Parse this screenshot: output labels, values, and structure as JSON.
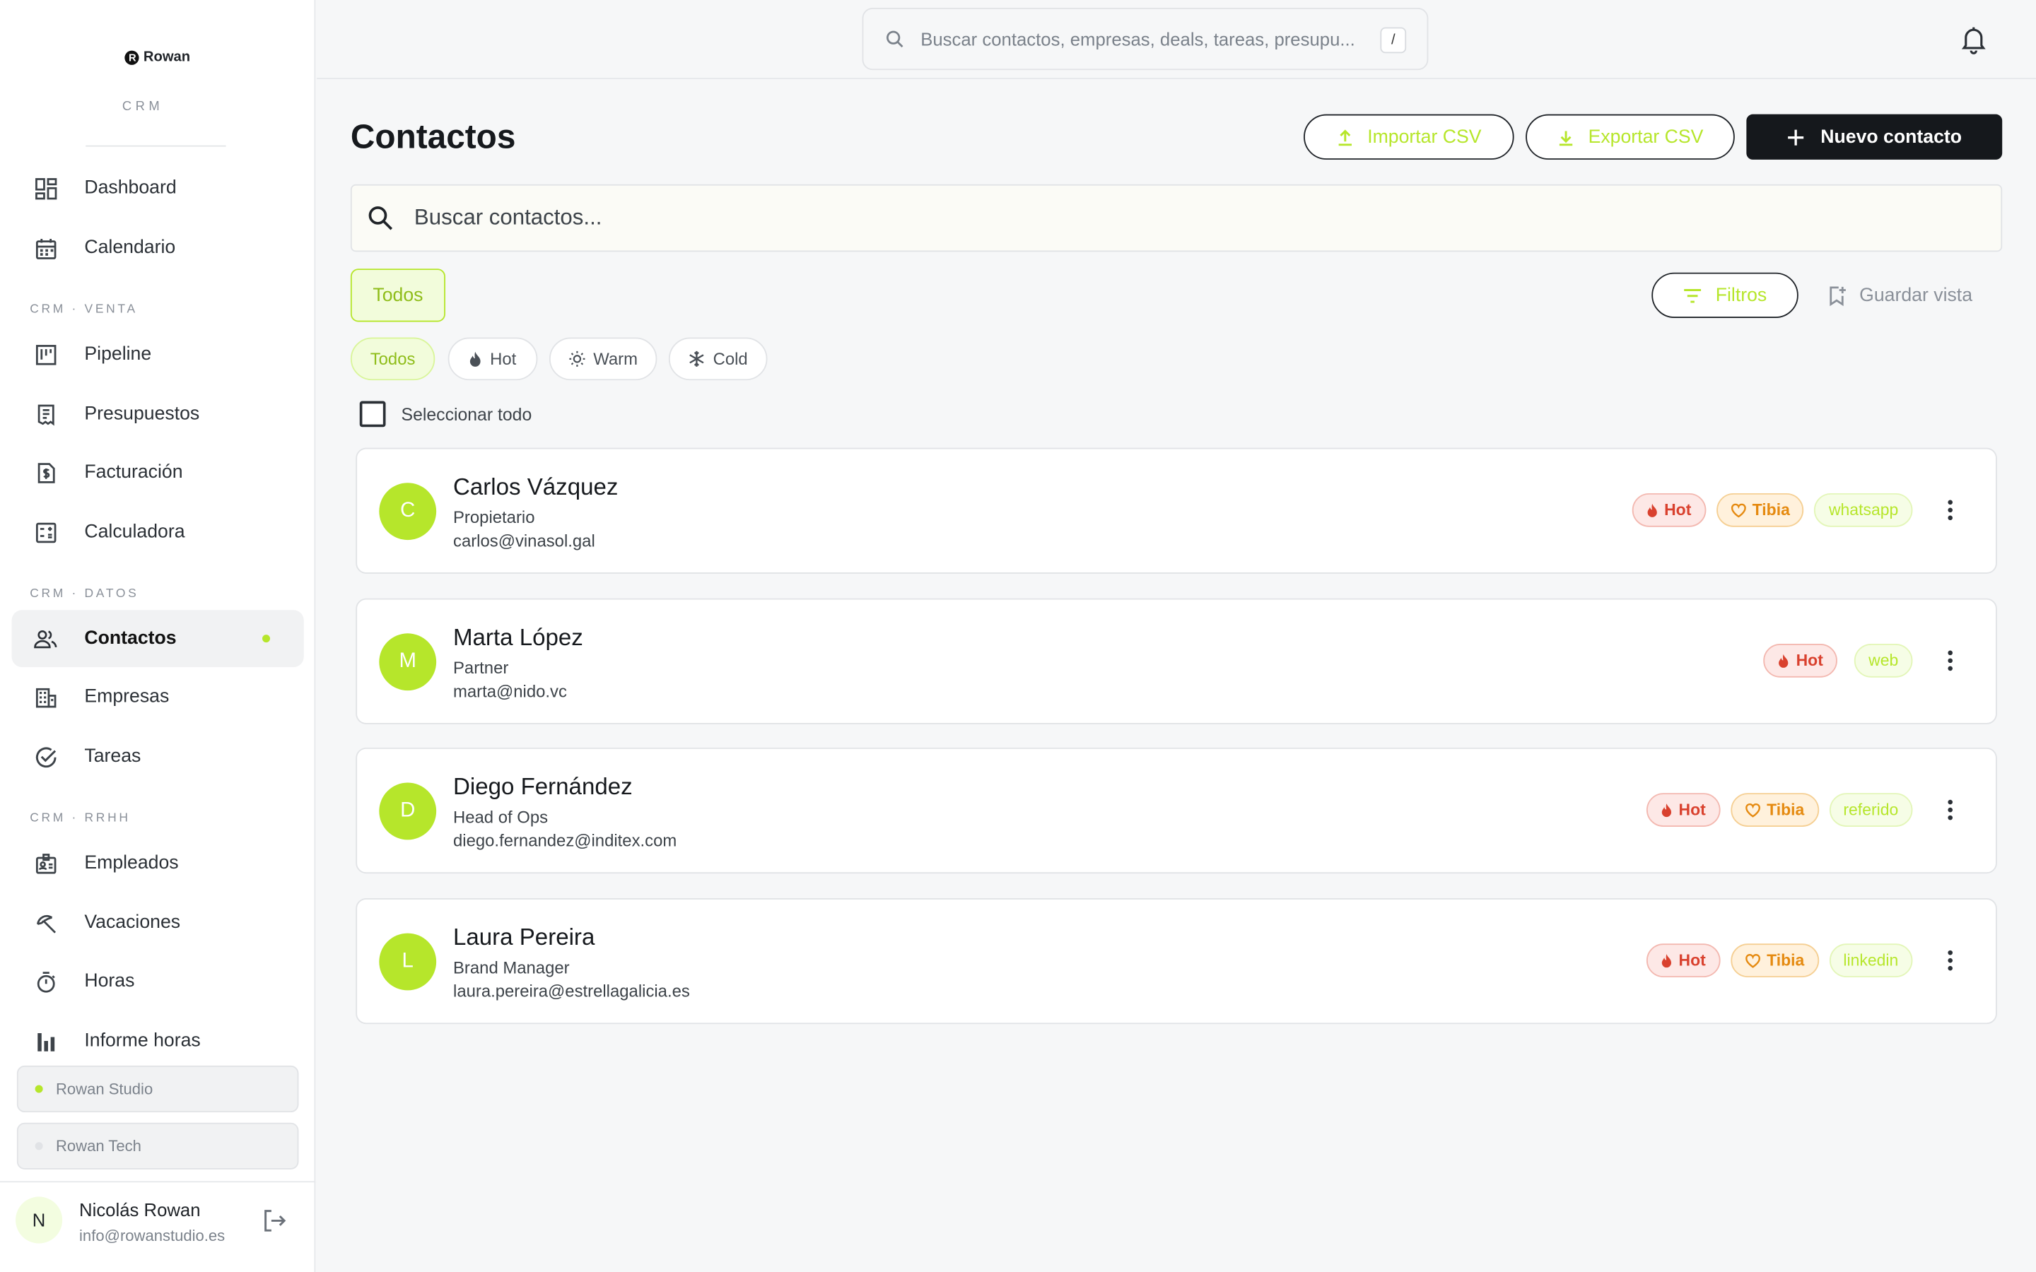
{
  "brand": {
    "logo_text": "Rowan",
    "logo_mark": "R",
    "sub": "CRM"
  },
  "sidebar": {
    "items_top": [
      {
        "label": "Dashboard",
        "icon": "dashboard-icon"
      },
      {
        "label": "Calendario",
        "icon": "calendar-icon"
      }
    ],
    "section_venta": "CRM · VENTA",
    "items_venta": [
      {
        "label": "Pipeline",
        "icon": "pipeline-icon"
      },
      {
        "label": "Presupuestos",
        "icon": "receipt-icon"
      },
      {
        "label": "Facturación",
        "icon": "invoice-icon"
      },
      {
        "label": "Calculadora",
        "icon": "calculator-icon"
      }
    ],
    "section_datos": "CRM · DATOS",
    "items_datos": [
      {
        "label": "Contactos",
        "icon": "people-icon",
        "active": true
      },
      {
        "label": "Empresas",
        "icon": "building-icon"
      },
      {
        "label": "Tareas",
        "icon": "check-circle-icon"
      }
    ],
    "section_rrhh": "CRM · RRHH",
    "items_rrhh": [
      {
        "label": "Empleados",
        "icon": "badge-icon"
      },
      {
        "label": "Vacaciones",
        "icon": "beach-icon"
      },
      {
        "label": "Horas",
        "icon": "timer-icon"
      },
      {
        "label": "Informe horas",
        "icon": "bar-chart-icon"
      }
    ],
    "workspaces": [
      {
        "label": "Rowan Studio",
        "dot_color": "#b6e62b"
      },
      {
        "label": "Rowan Tech",
        "dot_color": "#e1e3e6"
      }
    ],
    "user": {
      "initial": "N",
      "name": "Nicolás Rowan",
      "email": "info@rowanstudio.es"
    }
  },
  "topbar": {
    "search_placeholder": "Buscar contactos, empresas, deals, tareas, presupu...",
    "shortcut": "/"
  },
  "page": {
    "title": "Contactos",
    "import_label": "Importar CSV",
    "export_label": "Exportar CSV",
    "new_label": "Nuevo contacto",
    "search_placeholder": "Buscar contactos...",
    "tab_all": "Todos",
    "filters_label": "Filtros",
    "save_view_label": "Guardar vista",
    "chips": [
      "Todos",
      "Hot",
      "Warm",
      "Cold"
    ],
    "select_all": "Seleccionar todo"
  },
  "contacts": [
    {
      "initial": "C",
      "name": "Carlos Vázquez",
      "role": "Propietario",
      "email": "carlos@vinasol.gal",
      "tags": [
        "Hot",
        "Tibia",
        "whatsapp"
      ]
    },
    {
      "initial": "M",
      "name": "Marta López",
      "role": "Partner",
      "email": "marta@nido.vc",
      "tags": [
        "Hot",
        "web"
      ]
    },
    {
      "initial": "D",
      "name": "Diego Fernández",
      "role": "Head of Ops",
      "email": "diego.fernandez@inditex.com",
      "tags": [
        "Hot",
        "Tibia",
        "referido"
      ]
    },
    {
      "initial": "L",
      "name": "Laura Pereira",
      "role": "Brand Manager",
      "email": "laura.pereira@estrellagalicia.es",
      "tags": [
        "Hot",
        "Tibia",
        "linkedin"
      ]
    }
  ],
  "colors": {
    "accent": "#b6e62b",
    "hot": "#d9412e",
    "tibia": "#e58a10",
    "dark": "#15181c"
  }
}
